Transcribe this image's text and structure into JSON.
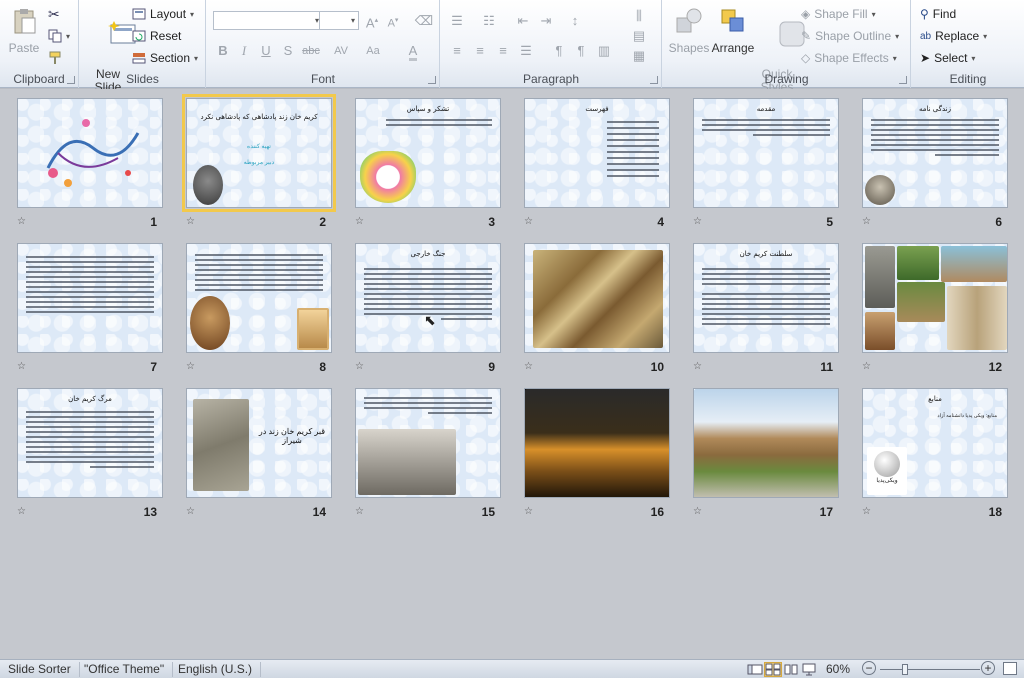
{
  "ribbon": {
    "clipboard": {
      "label": "Clipboard",
      "paste": "Paste"
    },
    "slides": {
      "label": "Slides",
      "new_slide": "New\nSlide",
      "layout": "Layout",
      "reset": "Reset",
      "section": "Section"
    },
    "font": {
      "label": "Font"
    },
    "paragraph": {
      "label": "Paragraph"
    },
    "drawing": {
      "label": "Drawing",
      "shapes": "Shapes",
      "arrange": "Arrange",
      "quick_styles": "Quick\nStyles",
      "shape_fill": "Shape Fill",
      "shape_outline": "Shape Outline",
      "shape_effects": "Shape Effects"
    },
    "editing": {
      "label": "Editing",
      "find": "Find",
      "replace": "Replace",
      "select": "Select"
    }
  },
  "slides": [
    {
      "num": "1",
      "title": ""
    },
    {
      "num": "2",
      "title": "کریم خان زند پادشاهی که پادشاهی نکرد"
    },
    {
      "num": "3",
      "title": "تشکر و سپاس"
    },
    {
      "num": "4",
      "title": "فهرست"
    },
    {
      "num": "5",
      "title": "مقدمه"
    },
    {
      "num": "6",
      "title": "زندگی نامه"
    },
    {
      "num": "7",
      "title": ""
    },
    {
      "num": "8",
      "title": ""
    },
    {
      "num": "9",
      "title": "جنگ خارجی"
    },
    {
      "num": "10",
      "title": ""
    },
    {
      "num": "11",
      "title": "سلطنت کریم خان"
    },
    {
      "num": "12",
      "title": ""
    },
    {
      "num": "13",
      "title": "مرگ کریم خان"
    },
    {
      "num": "14",
      "title": "قبر کریم خان زند در شیراز"
    },
    {
      "num": "15",
      "title": ""
    },
    {
      "num": "16",
      "title": ""
    },
    {
      "num": "17",
      "title": ""
    },
    {
      "num": "18",
      "title": "منابع"
    }
  ],
  "slide_extra": {
    "s2_line1": "تهیه کننده",
    "s2_line2": "دبیر مربوطه",
    "s18_line": "منابع: ویکی پدیا دانشنامه آزاد",
    "s18_logo": "ویکی‌پدیا"
  },
  "status": {
    "view": "Slide Sorter",
    "theme": "\"Office Theme\"",
    "language": "English (U.S.)",
    "zoom": "60%"
  },
  "colors": {
    "selected_outline": "#f2c94c",
    "slide_bg": "#dde9f7"
  }
}
